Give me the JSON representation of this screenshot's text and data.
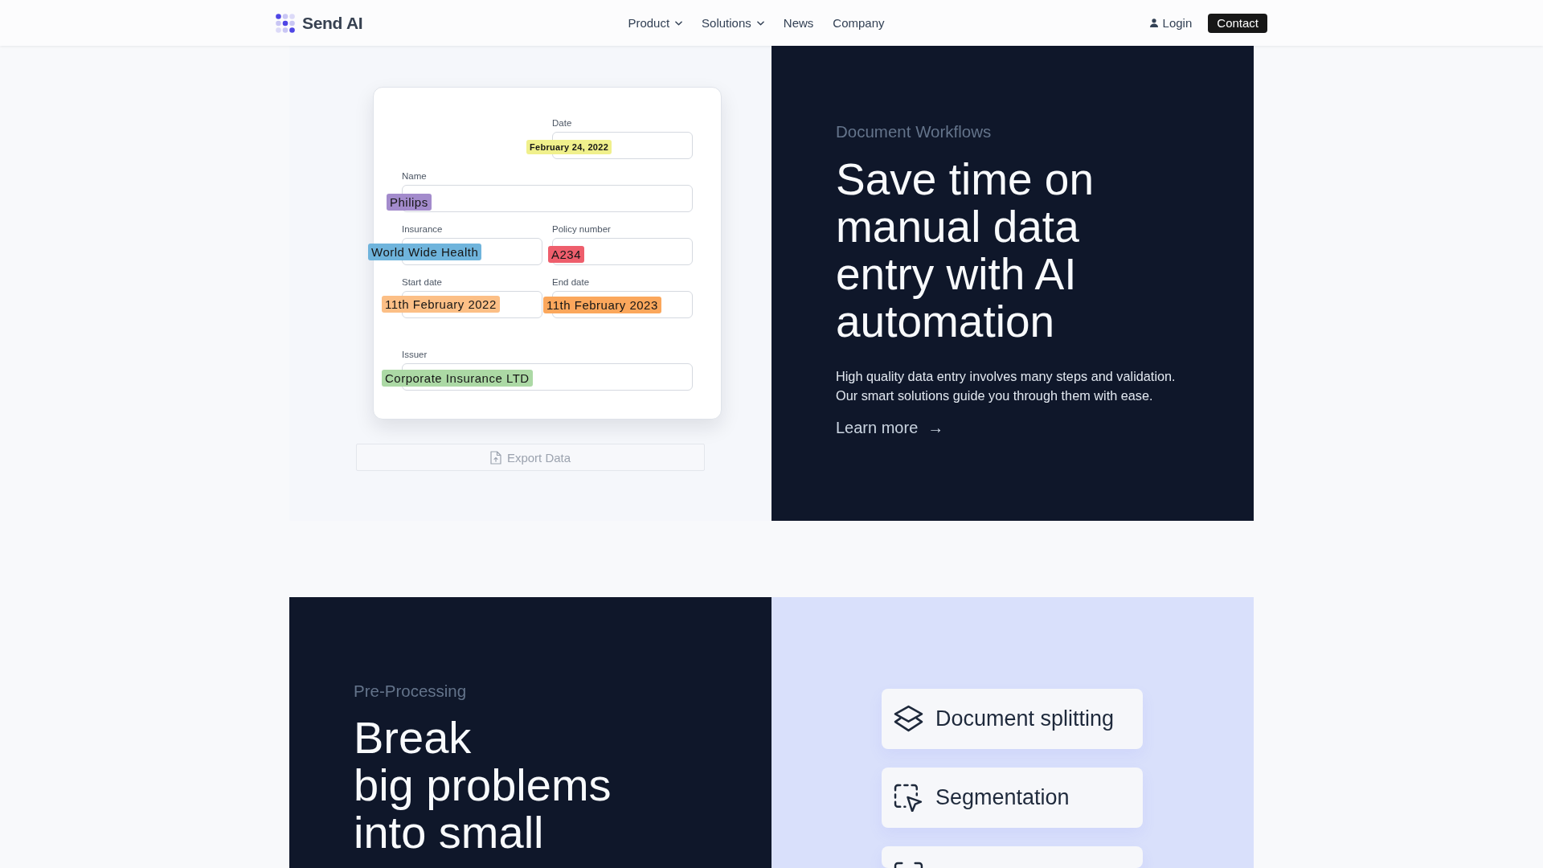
{
  "nav": {
    "brand": "Send AI",
    "links": [
      {
        "label": "Product",
        "dropdown": true
      },
      {
        "label": "Solutions",
        "dropdown": true
      },
      {
        "label": "News",
        "dropdown": false
      },
      {
        "label": "Company",
        "dropdown": false
      }
    ],
    "login": "Login",
    "contact": "Contact"
  },
  "workflows": {
    "form": {
      "fields": [
        {
          "label": "Date",
          "tag": {
            "text": "February 24, 2022",
            "color": "#f0f08c"
          }
        },
        {
          "label": "Name",
          "tag": {
            "text": "Philips",
            "color": "#a38bcc"
          }
        },
        {
          "label": "Insurance",
          "tag": {
            "text": "World Wide Health",
            "color": "#6fb4dc"
          }
        },
        {
          "label": "Policy number",
          "tag": {
            "text": "A234",
            "color": "#ee5e6c"
          }
        },
        {
          "label": "Start date",
          "tag": {
            "text": "11th February 2022",
            "color": "#fcbf86"
          }
        },
        {
          "label": "End date",
          "tag": {
            "text": "11th February 2023",
            "color": "#fba75c"
          }
        },
        {
          "label": "Issuer",
          "tag": {
            "text": "Corporate Insurance LTD",
            "color": "#acd9a5"
          }
        }
      ]
    },
    "export_button": {
      "label": "Export Data",
      "disabled": true
    },
    "eyebrow": "Document Workflows",
    "heading": "Save time on manual data entry with AI automation",
    "description": "High quality data entry involves many steps and validation. Our smart solutions guide you through them with ease.",
    "link": {
      "label": "Learn more",
      "arrow": "→"
    }
  },
  "pre_processing": {
    "eyebrow": "Pre-Processing",
    "heading_lines": [
      "Break",
      "big problems into small"
    ],
    "cards": [
      {
        "kind": "layers",
        "label": "Document splitting"
      },
      {
        "kind": "selection",
        "label": "Segmentation"
      },
      {
        "kind": "corners"
      }
    ]
  }
}
